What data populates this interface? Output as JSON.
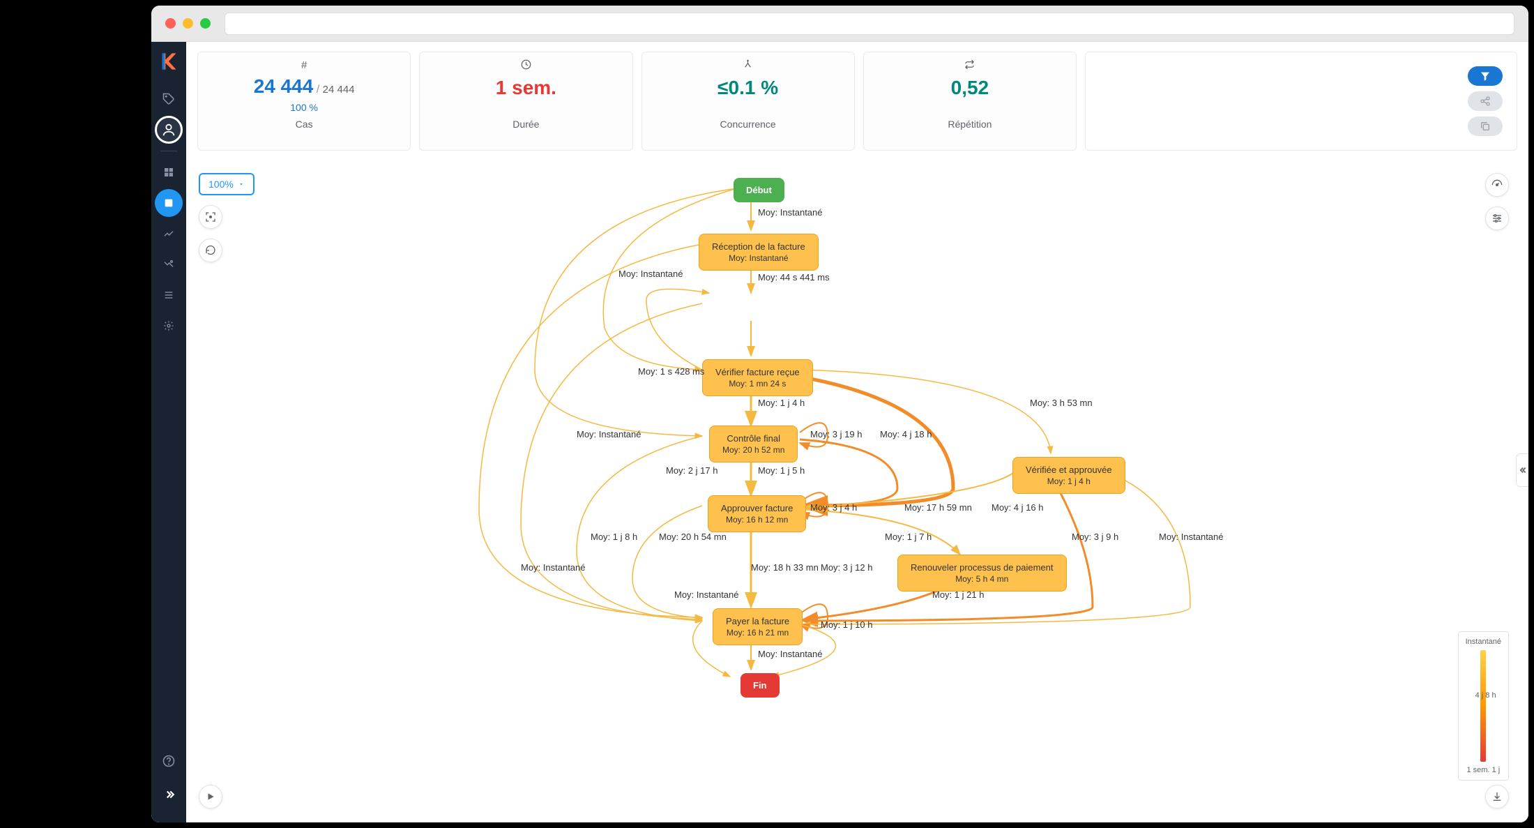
{
  "metrics": {
    "cas": {
      "value": "24 444",
      "total": "24 444",
      "percent": "100 %",
      "label": "Cas"
    },
    "duree": {
      "value": "1 sem.",
      "label": "Durée"
    },
    "concurrence": {
      "value": "≤0.1 %",
      "label": "Concurrence"
    },
    "repetition": {
      "value": "0,52",
      "label": "Répétition"
    }
  },
  "zoom": {
    "level": "100%"
  },
  "legend": {
    "top": "Instantané",
    "mid": "4 j 8 h",
    "bottom": "1 sem. 1 j"
  },
  "nodes": {
    "start": {
      "label": "Début"
    },
    "reception": {
      "title": "Réception de la facture",
      "sub": "Moy: Instantané"
    },
    "verifier": {
      "title": "Vérifier facture reçue",
      "sub": "Moy: 1 mn 24 s"
    },
    "controle": {
      "title": "Contrôle final",
      "sub": "Moy: 20 h 52 mn"
    },
    "verifiee": {
      "title": "Vérifiée et approuvée",
      "sub": "Moy: 1 j 4 h"
    },
    "approuver": {
      "title": "Approuver facture",
      "sub": "Moy: 16 h 12 mn"
    },
    "renouveler": {
      "title": "Renouveler processus de paiement",
      "sub": "Moy: 5 h 4 mn"
    },
    "payer": {
      "title": "Payer la facture",
      "sub": "Moy: 16 h 21 mn"
    },
    "end": {
      "label": "Fin"
    }
  },
  "edges": {
    "e1": "Moy: Instantané",
    "e2": "Moy: 44 s 441 ms",
    "e3": "Moy: 1 s 428 ms",
    "e4": "Moy: Instantané",
    "e5": "Moy: 1 j 4 h",
    "e6": "Moy: 3 h 53 mn",
    "e7": "Moy: Instantané",
    "e8": "Moy: 3 j 19 h",
    "e9": "Moy: 4 j 18 h",
    "e10": "Moy: 1 j 5 h",
    "e11": "Moy: 2 j 17 h",
    "e12": "Moy: 3 j 4 h",
    "e13": "Moy: 17 h 59 mn",
    "e14": "Moy: 4 j 16 h",
    "e15": "Moy: 1 j 8 h",
    "e16": "Moy: 20 h 54 mn",
    "e17": "Moy: 18 h 33 mn",
    "e18": "Moy: 3 j 12 h",
    "e19": "Moy: 1 j 7 h",
    "e20": "Moy: Instantané",
    "e21": "Moy: Instantané",
    "e22": "Moy: 1 j 21 h",
    "e23": "Moy: 3 j 9 h",
    "e24": "Moy: Instantané",
    "e25": "Moy: 1 j 10 h",
    "e26": "Moy: Instantané"
  }
}
